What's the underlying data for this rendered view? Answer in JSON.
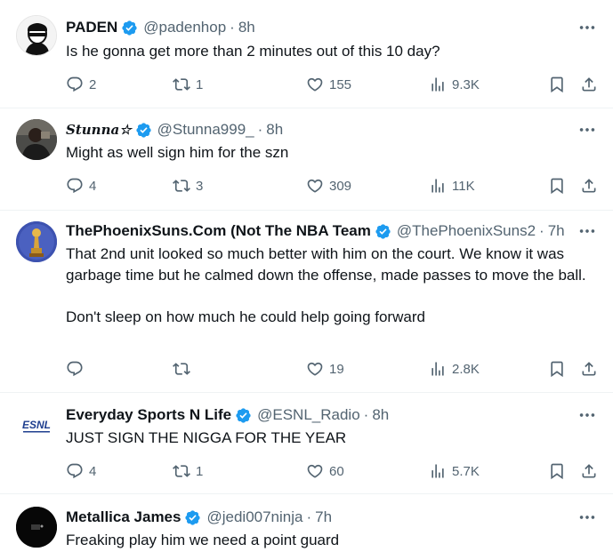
{
  "tweets": [
    {
      "name": "PADEN",
      "handle": "@padenhop",
      "time": "8h",
      "text": "Is he gonna get more than 2 minutes out of this 10 day?",
      "replies": "2",
      "retweets": "1",
      "likes": "155",
      "views": "9.3K",
      "avatar_icon": "cartoon-person-avatar"
    },
    {
      "name": "Stunna☆",
      "handle": "@Stunna999_",
      "time": "8h",
      "text": "Might as well sign him for the szn",
      "replies": "4",
      "retweets": "3",
      "likes": "309",
      "views": "11K",
      "avatar_icon": "person-photo-avatar"
    },
    {
      "name": "ThePhoenixSuns.Com (Not The NBA Team",
      "handle": "@ThePhoenixSuns2",
      "time": "7h",
      "text": "That 2nd unit looked so much better with him on the court. We know it was garbage time but he calmed down the offense, made passes to move the ball.\n\nDon't sleep on how much he could help going forward",
      "replies": "",
      "retweets": "",
      "likes": "19",
      "views": "2.8K",
      "avatar_icon": "trophy-avatar"
    },
    {
      "name": "Everyday Sports N Life",
      "handle": "@ESNL_Radio",
      "time": "8h",
      "text": "JUST SIGN THE NIGGA FOR THE YEAR",
      "replies": "4",
      "retweets": "1",
      "likes": "60",
      "views": "5.7K",
      "avatar_icon": "esnl-logo-avatar",
      "avatar_text": "ESNL"
    },
    {
      "name": "Metallica James",
      "handle": "@jedi007ninja",
      "time": "7h",
      "text": "Freaking play him we need a point guard",
      "avatar_icon": "dark-photo-avatar"
    }
  ],
  "colors": {
    "verified": "#1d9bf0",
    "secondary_text": "#536471",
    "primary_text": "#0f1419",
    "divider": "#eff3f4"
  },
  "dot": "·"
}
